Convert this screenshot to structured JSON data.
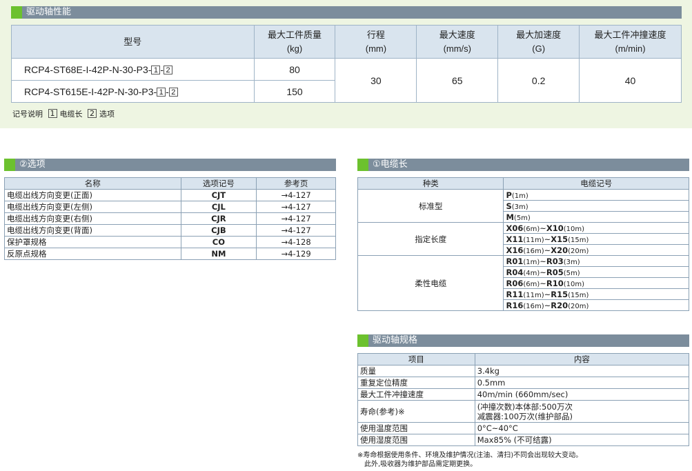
{
  "performance": {
    "title": "驱动轴性能",
    "headers": {
      "model": "型号",
      "payload": "最大工件质量",
      "payload_unit": "(kg)",
      "stroke": "行程",
      "stroke_unit": "(mm)",
      "speed": "最大速度",
      "speed_unit": "(mm/s)",
      "accel": "最大加速度",
      "accel_unit": "(G)",
      "impact": "最大工件冲撞速度",
      "impact_unit": "(m/min)"
    },
    "rows": [
      {
        "model_prefix": "RCP4-ST68E-I-42P-N-30-P3-",
        "box1": "1",
        "sep": "-",
        "box2": "2",
        "payload": "80"
      },
      {
        "model_prefix": "RCP4-ST615E-I-42P-N-30-P3-",
        "box1": "1",
        "sep": "-",
        "box2": "2",
        "payload": "150"
      }
    ],
    "shared": {
      "stroke": "30",
      "speed": "65",
      "accel": "0.2",
      "impact": "40"
    },
    "legend": {
      "label": "记号说明",
      "box1": "1",
      "item1": "电缆长",
      "box2": "2",
      "item2": "选项"
    }
  },
  "options": {
    "title": "②选项",
    "headers": {
      "name": "名称",
      "code": "选项记号",
      "page": "参考页"
    },
    "rows": [
      {
        "name": "电缆出线方向变更(正面)",
        "code": "CJT",
        "page": "→4-127"
      },
      {
        "name": "电缆出线方向变更(左侧)",
        "code": "CJL",
        "page": "→4-127"
      },
      {
        "name": "电缆出线方向变更(右侧)",
        "code": "CJR",
        "page": "→4-127"
      },
      {
        "name": "电缆出线方向变更(背面)",
        "code": "CJB",
        "page": "→4-127"
      },
      {
        "name": "保护罩规格",
        "code": "CO",
        "page": "→4-128"
      },
      {
        "name": "反原点规格",
        "code": "NM",
        "page": "→4-129"
      }
    ]
  },
  "cable": {
    "title": "①电缆长",
    "headers": {
      "kind": "种类",
      "code": "电缆记号"
    },
    "groups": [
      {
        "kind": "标准型",
        "rows": [
          {
            "a": "P",
            "al": "(1m)",
            "tilde": "",
            "b": "",
            "bl": ""
          },
          {
            "a": "S",
            "al": "(3m)",
            "tilde": "",
            "b": "",
            "bl": ""
          },
          {
            "a": "M",
            "al": "(5m)",
            "tilde": "",
            "b": "",
            "bl": ""
          }
        ]
      },
      {
        "kind": "指定长度",
        "rows": [
          {
            "a": "X06",
            "al": "(6m)",
            "tilde": "~",
            "b": "X10",
            "bl": "(10m)"
          },
          {
            "a": "X11",
            "al": "(11m)",
            "tilde": "~",
            "b": "X15",
            "bl": "(15m)"
          },
          {
            "a": "X16",
            "al": "(16m)",
            "tilde": "~",
            "b": "X20",
            "bl": "(20m)"
          }
        ]
      },
      {
        "kind": "柔性电缆",
        "rows": [
          {
            "a": "R01",
            "al": "(1m)",
            "tilde": "~",
            "b": "R03",
            "bl": "(3m)"
          },
          {
            "a": "R04",
            "al": "(4m)",
            "tilde": "~",
            "b": "R05",
            "bl": "(5m)"
          },
          {
            "a": "R06",
            "al": "(6m)",
            "tilde": "~",
            "b": "R10",
            "bl": "(10m)"
          },
          {
            "a": "R11",
            "al": "(11m)",
            "tilde": "~",
            "b": "R15",
            "bl": "(15m)"
          },
          {
            "a": "R16",
            "al": "(16m)",
            "tilde": "~",
            "b": "R20",
            "bl": "(20m)"
          }
        ]
      }
    ]
  },
  "spec": {
    "title": "驱动轴规格",
    "headers": {
      "item": "项目",
      "content": "内容"
    },
    "rows": [
      {
        "item": "质量",
        "content": "3.4kg",
        "content2": ""
      },
      {
        "item": "重复定位精度",
        "content": "0.5mm",
        "content2": ""
      },
      {
        "item": "最大工件冲撞速度",
        "content": "40m/min (660mm/sec)",
        "content2": ""
      },
      {
        "item": "寿命(参考)※",
        "content": "(冲撞次数)本体部:500万次",
        "content2": "减震器:100万次(维护部品)"
      },
      {
        "item": "使用温度范围",
        "content": "0°C~40°C",
        "content2": ""
      },
      {
        "item": "使用湿度范围",
        "content": "Max85% (不可结露)",
        "content2": ""
      }
    ],
    "note1": "※寿命根据使用条件、环境及维护情况(注油、清扫)不同会出现较大变动。",
    "note2": "此外,吸收器为维护部品需定期更换。"
  }
}
